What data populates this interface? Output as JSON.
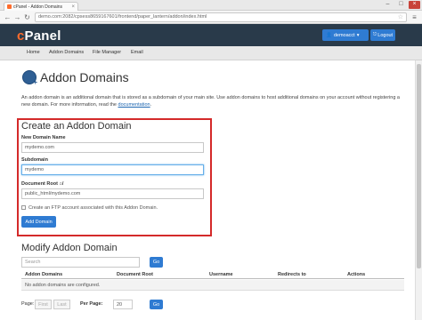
{
  "browser": {
    "tab_title": "cPanel - Addon Domains",
    "url": "demo.com:2082/cpsess8659167601/frontend/paper_lantern/addon/index.html"
  },
  "header": {
    "logo": "cPanel",
    "user_label": "demoacct",
    "logout_label": "Logout"
  },
  "nav": {
    "items": [
      "Home",
      "Addon Domains",
      "File Manager",
      "Email"
    ]
  },
  "page": {
    "title": "Addon Domains",
    "description": "An addon domain is an additional domain that is stored as a subdomain of your main site. Use addon domains to host additional domains on your account without registering a new domain. For more information, read the",
    "description_link": "documentation",
    "description_end": "."
  },
  "create": {
    "title": "Create an Addon Domain",
    "new_domain_label": "New Domain Name",
    "new_domain_value": "mydemo.com",
    "subdomain_label": "Subdomain",
    "subdomain_value": "mydemo",
    "docroot_label": "Document Root",
    "docroot_value": "public_html/mydemo.com",
    "ftp_checkbox_label": "Create an FTP account associated with this Addon Domain.",
    "submit_label": "Add Domain"
  },
  "modify": {
    "title": "Modify Addon Domain",
    "search_placeholder": "Search",
    "go_label": "Go",
    "columns": [
      "Addon Domains",
      "Document Root",
      "Username",
      "Redirects to",
      "Actions"
    ],
    "empty_message": "No addon domains are configured."
  },
  "pager": {
    "page_label": "Page:",
    "first_label": "First",
    "last_label": "Last",
    "per_page_label": "Per Page:",
    "per_page_value": "20",
    "go_label": "Go"
  },
  "colors": {
    "header_bg": "#293a4a",
    "brand_orange": "#ff6c2c",
    "primary_blue": "#2f7bd2",
    "highlight_red": "#d42a2a"
  }
}
